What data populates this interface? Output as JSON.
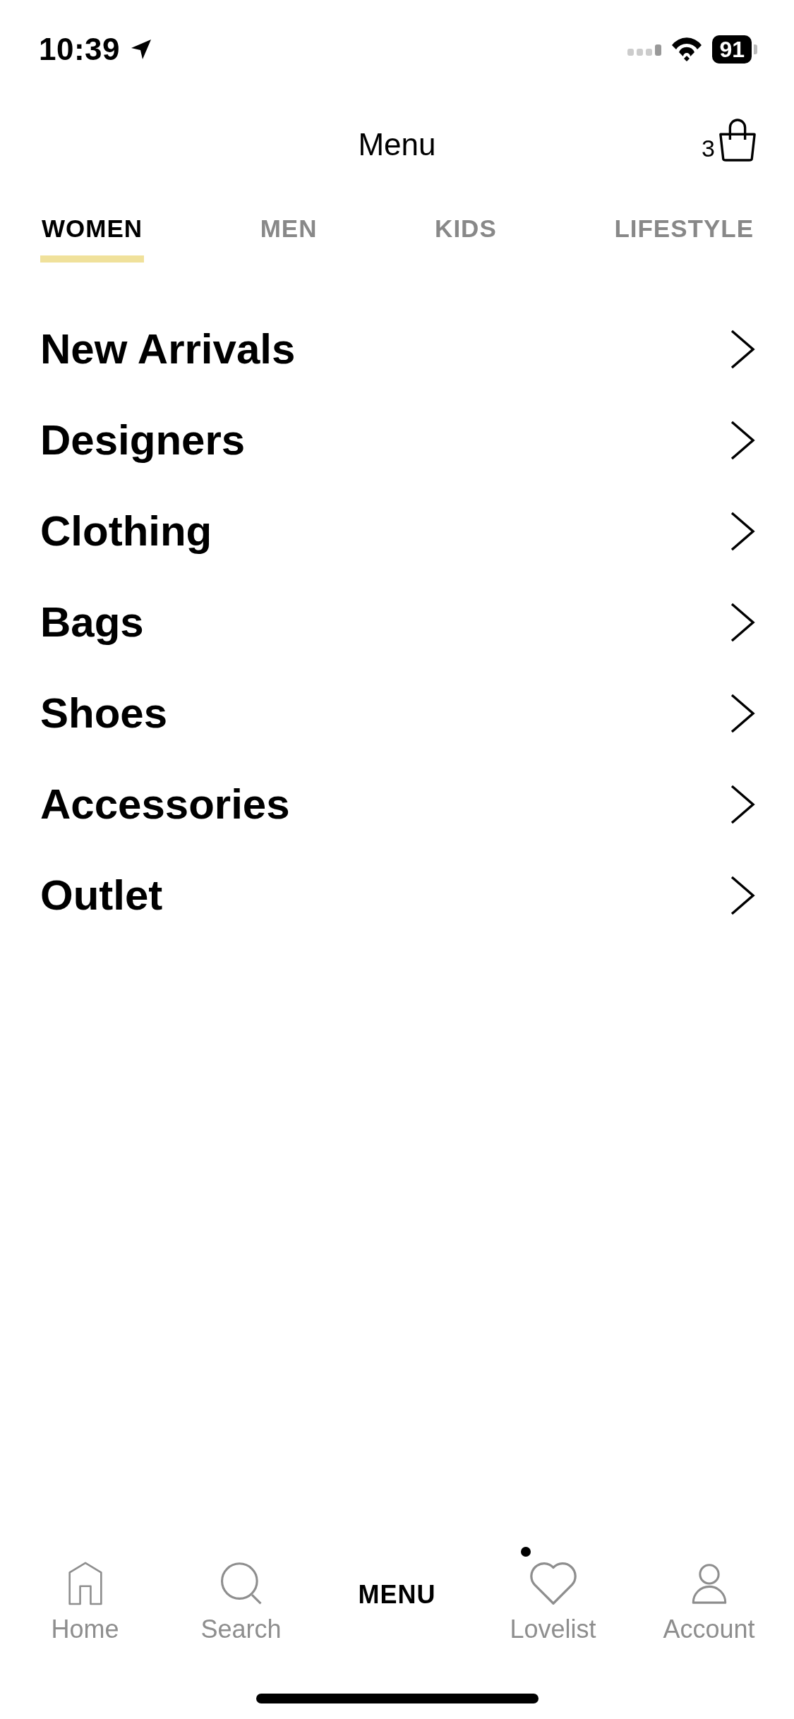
{
  "status_bar": {
    "time": "10:39",
    "battery": "91"
  },
  "header": {
    "title": "Menu",
    "cart_count": "3"
  },
  "tabs": [
    {
      "label": "WOMEN",
      "selected": true
    },
    {
      "label": "MEN",
      "selected": false
    },
    {
      "label": "KIDS",
      "selected": false
    },
    {
      "label": "LIFESTYLE",
      "selected": false
    }
  ],
  "menu_items": [
    {
      "label": "New Arrivals"
    },
    {
      "label": "Designers"
    },
    {
      "label": "Clothing"
    },
    {
      "label": "Bags"
    },
    {
      "label": "Shoes"
    },
    {
      "label": "Accessories"
    },
    {
      "label": "Outlet"
    }
  ],
  "bottom_nav": [
    {
      "label": "Home",
      "kind": "home",
      "selected": false,
      "badge": false
    },
    {
      "label": "Search",
      "kind": "search",
      "selected": false,
      "badge": false
    },
    {
      "label": "MENU",
      "kind": "menu",
      "selected": true,
      "badge": false
    },
    {
      "label": "Lovelist",
      "kind": "heart",
      "selected": false,
      "badge": true
    },
    {
      "label": "Account",
      "kind": "person",
      "selected": false,
      "badge": false
    }
  ]
}
